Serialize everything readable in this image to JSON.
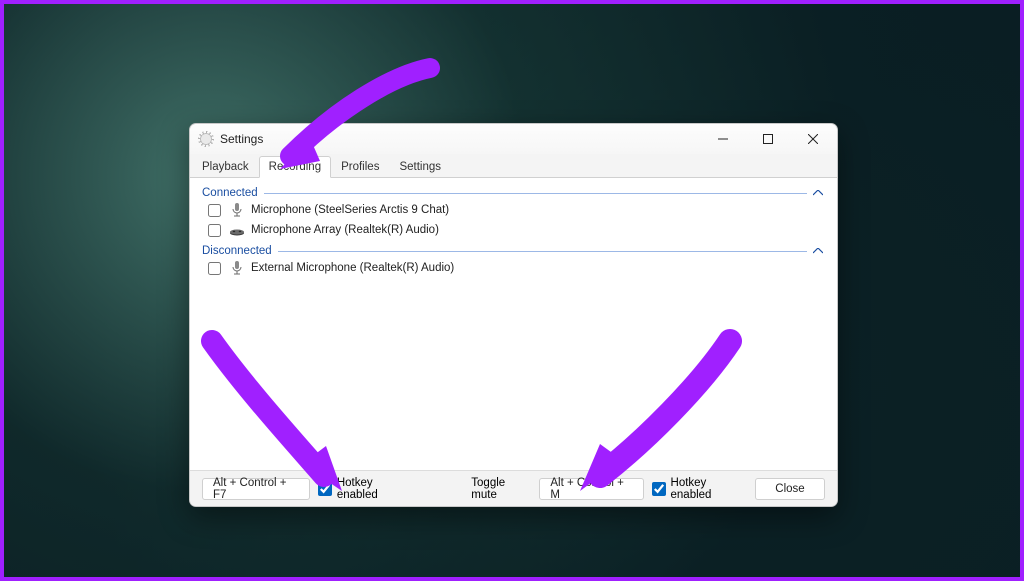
{
  "window": {
    "title": "Settings"
  },
  "tabs": [
    {
      "label": "Playback",
      "active": false
    },
    {
      "label": "Recording",
      "active": true
    },
    {
      "label": "Profiles",
      "active": false
    },
    {
      "label": "Settings",
      "active": false
    }
  ],
  "groups": {
    "connected": {
      "label": "Connected",
      "devices": [
        {
          "checked": false,
          "name": "Microphone (SteelSeries Arctis 9 Chat)"
        },
        {
          "checked": false,
          "name": "Microphone Array (Realtek(R) Audio)"
        }
      ]
    },
    "disconnected": {
      "label": "Disconnected",
      "devices": [
        {
          "checked": false,
          "name": "External Microphone (Realtek(R) Audio)"
        }
      ]
    }
  },
  "bottombar": {
    "hotkey1_value": "Alt + Control + F7",
    "hotkey1_enabled_label": "Hotkey enabled",
    "hotkey1_enabled_checked": true,
    "toggle_mute_label": "Toggle mute",
    "hotkey2_value": "Alt + Control + M",
    "hotkey2_enabled_label": "Hotkey enabled",
    "hotkey2_enabled_checked": true,
    "close_label": "Close"
  },
  "colors": {
    "accent_border": "#a020ff",
    "arrow": "#a020ff",
    "group_header": "#1a4ea1"
  }
}
